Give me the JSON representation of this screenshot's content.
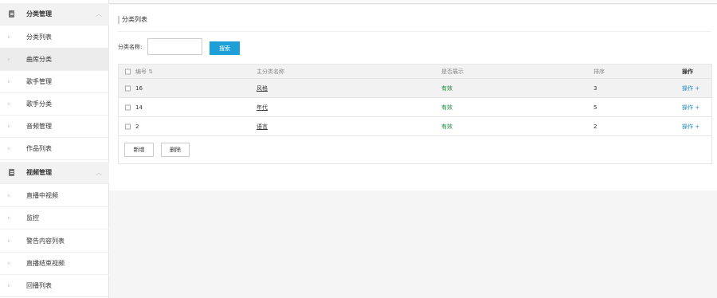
{
  "sidebar": {
    "groups": [
      {
        "label": "分类管理",
        "icon": "document-icon",
        "items": [
          "分类列表",
          "曲库分类",
          "歌手管理",
          "歌手分类",
          "音频管理",
          "作品列表"
        ]
      },
      {
        "label": "视频管理",
        "icon": "document-icon",
        "items": [
          "直播中视频",
          "监控",
          "警告内容列表",
          "直播结束视频",
          "回播列表"
        ]
      }
    ],
    "active_item": "曲库分类"
  },
  "panel": {
    "title": "分类列表"
  },
  "search": {
    "label": "分类名称:",
    "input_value": "",
    "button_label": "搜索"
  },
  "table": {
    "columns": [
      "编号",
      "主分类名称",
      "是否展示",
      "排序",
      "操作"
    ],
    "sort_icon": "⇅",
    "rows": [
      {
        "id": "16",
        "name": "风格",
        "show": "有效",
        "sort": "3",
        "op": "操作 +"
      },
      {
        "id": "14",
        "name": "年代",
        "show": "有效",
        "sort": "5",
        "op": "操作 +"
      },
      {
        "id": "2",
        "name": "语言",
        "show": "有效",
        "sort": "2",
        "op": "操作 +"
      }
    ],
    "add_button": "新增",
    "delete_button": "删除"
  },
  "colors": {
    "accent": "#1e9fd8",
    "status_ok": "#1a8a3c",
    "op_link": "#1e88c8"
  }
}
